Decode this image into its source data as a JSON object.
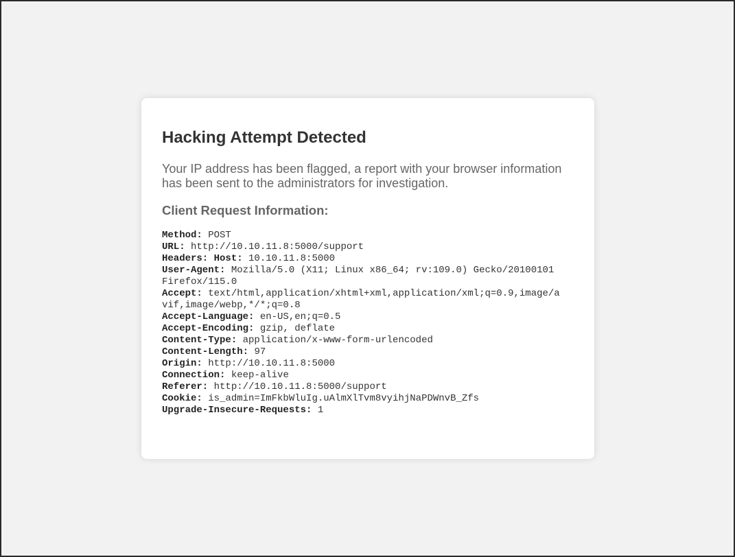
{
  "page": {
    "title": "Hacking Attempt Detected",
    "message": "Your IP address has been flagged, a report with your browser information has been sent to the administrators for investigation.",
    "subtitle": "Client Request Information:"
  },
  "request_info": [
    {
      "key": "Method:",
      "value": "POST"
    },
    {
      "key": "URL:",
      "value": "http://10.10.11.8:5000/support"
    },
    {
      "key": "Headers: Host:",
      "value": "10.10.11.8:5000"
    },
    {
      "key": "User-Agent:",
      "value": "Mozilla/5.0 (X11; Linux x86_64; rv:109.0) Gecko/20100101 Firefox/115.0"
    },
    {
      "key": "Accept:",
      "value": "text/html,application/xhtml+xml,application/xml;q=0.9,image/avif,image/webp,*/*;q=0.8"
    },
    {
      "key": "Accept-Language:",
      "value": "en-US,en;q=0.5"
    },
    {
      "key": "Accept-Encoding:",
      "value": "gzip, deflate"
    },
    {
      "key": "Content-Type:",
      "value": "application/x-www-form-urlencoded"
    },
    {
      "key": "Content-Length:",
      "value": "97"
    },
    {
      "key": "Origin:",
      "value": "http://10.10.11.8:5000"
    },
    {
      "key": "Connection:",
      "value": "keep-alive"
    },
    {
      "key": "Referer:",
      "value": "http://10.10.11.8:5000/support"
    },
    {
      "key": "Cookie:",
      "value": "is_admin=ImFkbWluIg.uAlmXlTvm8vyihjNaPDWnvB_Zfs"
    },
    {
      "key": "Upgrade-Insecure-Requests:",
      "value": "1"
    }
  ]
}
